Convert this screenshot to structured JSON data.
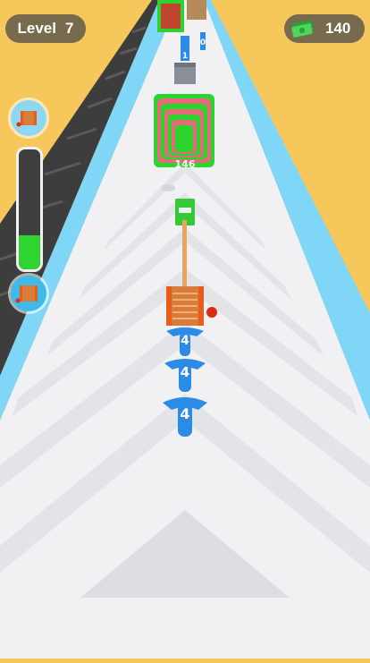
{
  "hud": {
    "level_label": "Level",
    "level_number": "7",
    "money": "140",
    "cash_icon": "cash-stack-icon"
  },
  "progress": {
    "fill_fraction": 0.28,
    "top_icon": "rope-roll-icon",
    "bottom_icon": "rope-roll-icon",
    "fill_color": "#2fd42f"
  },
  "track": {
    "big_stack_count": "146",
    "far_cup_number": "1",
    "far_pillar_number": "0",
    "hooks": [
      "4",
      "4",
      "4"
    ]
  },
  "colors": {
    "sky": "#f6c75b",
    "track_edge": "#7fd6f7",
    "hook_blue": "#2d8be8",
    "rope": "#e9a560"
  }
}
